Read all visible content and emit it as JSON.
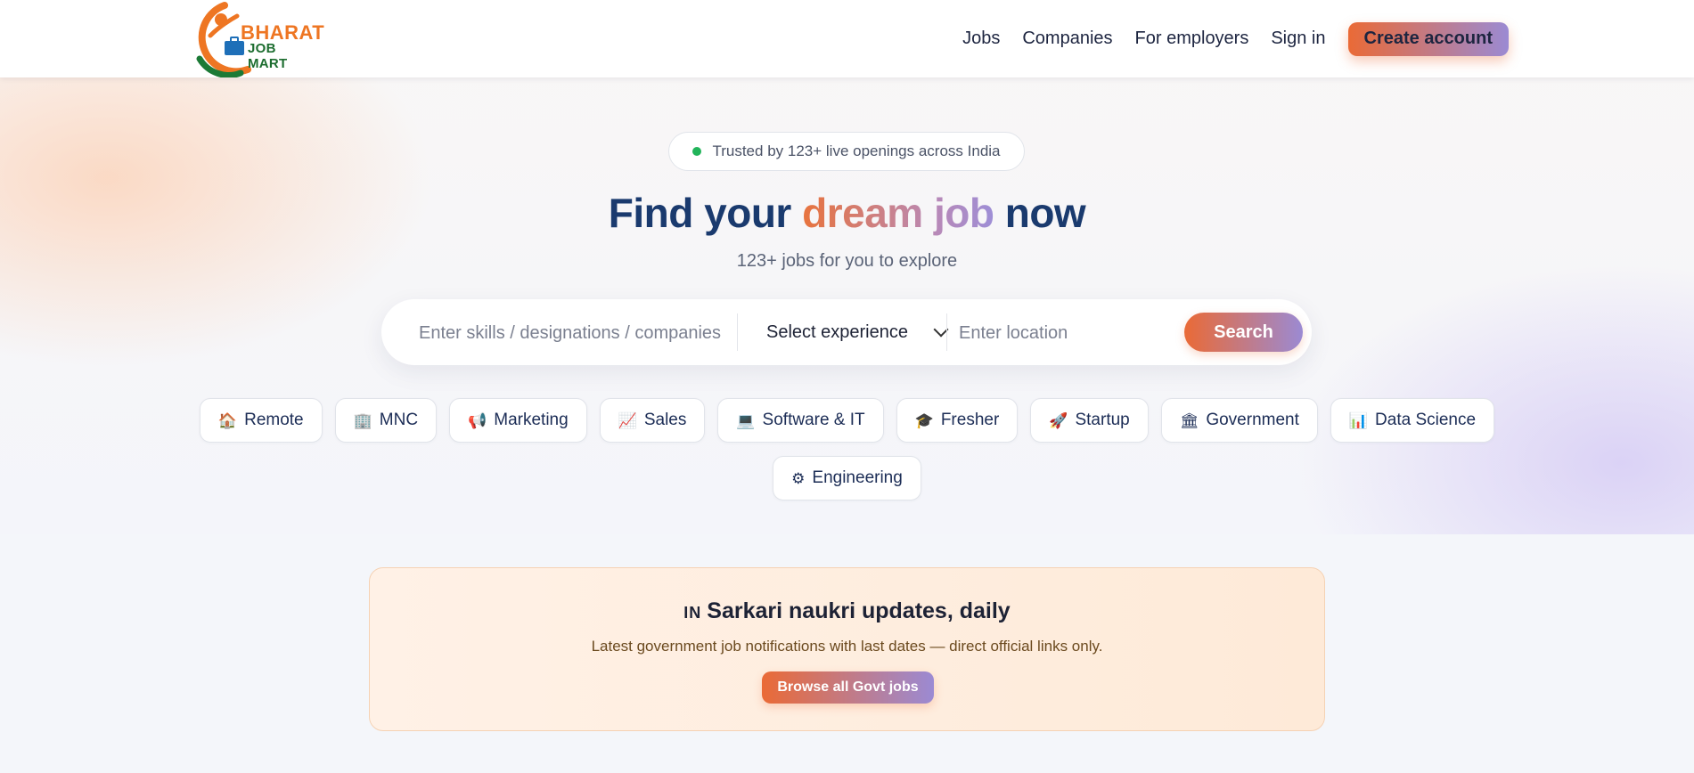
{
  "header": {
    "logo": {
      "line1": "BHARAT",
      "line2": "JOB MART"
    },
    "nav": {
      "jobs": "Jobs",
      "companies": "Companies",
      "employers": "For employers",
      "signin": "Sign in",
      "create_account": "Create account"
    }
  },
  "hero": {
    "badge_text": "Trusted by 123+ live openings across India",
    "headline": {
      "part1": "Find your",
      "highlight": "dream job",
      "part3": "now"
    },
    "subtitle": "123+ jobs for you to explore",
    "search": {
      "skills_placeholder": "Enter skills / designations / companies",
      "experience_selected": "Select experience",
      "location_placeholder": "Enter location",
      "button": "Search"
    }
  },
  "chips": [
    {
      "icon": "🏠",
      "label": "Remote"
    },
    {
      "icon": "🏢",
      "label": "MNC"
    },
    {
      "icon": "📢",
      "label": "Marketing"
    },
    {
      "icon": "📈",
      "label": "Sales"
    },
    {
      "icon": "💻",
      "label": "Software & IT"
    },
    {
      "icon": "🎓",
      "label": "Fresher"
    },
    {
      "icon": "🚀",
      "label": "Startup"
    },
    {
      "icon": "🏛",
      "label": "Government"
    },
    {
      "icon": "📊",
      "label": "Data Science"
    },
    {
      "icon": "⚙",
      "label": "Engineering"
    }
  ],
  "govt": {
    "badge": "IN",
    "title": "Sarkari naukri updates, daily",
    "description": "Latest government job notifications with last dates — direct official links only.",
    "button": "Browse all Govt jobs"
  },
  "colors": {
    "brand_orange": "#ea6a36",
    "brand_purple": "#9b8ad3",
    "navy": "#1a3a6e",
    "status_green": "#22b45a"
  }
}
